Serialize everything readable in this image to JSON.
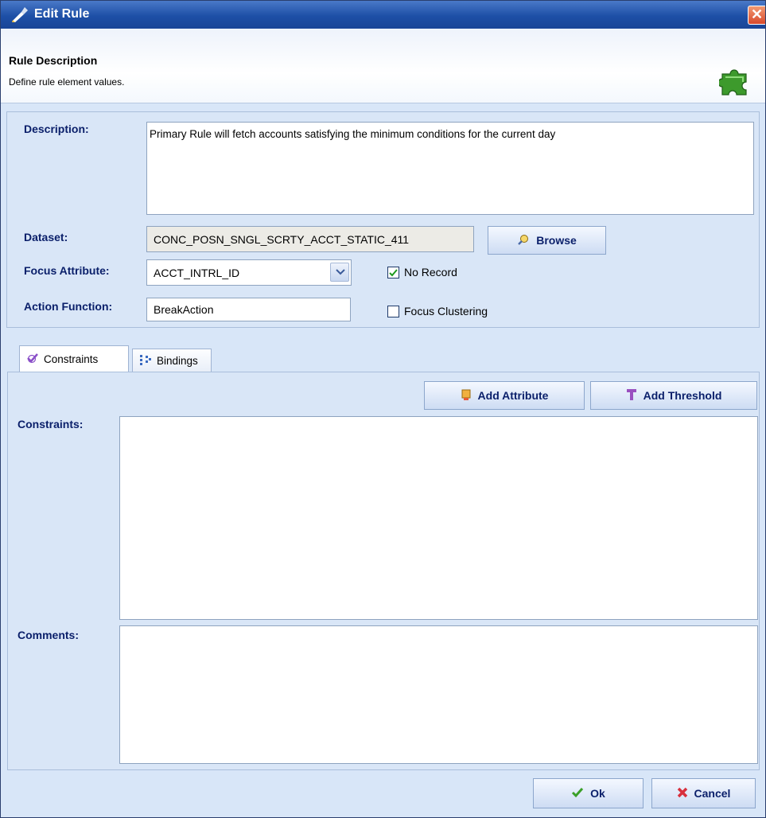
{
  "window": {
    "title": "Edit Rule",
    "close_glyph": "✕"
  },
  "header": {
    "title": "Rule Description",
    "subtitle": "Define rule element values."
  },
  "form": {
    "description_label": "Description:",
    "description_value": "Primary Rule will fetch accounts satisfying the minimum conditions  for the current day",
    "dataset_label": "Dataset:",
    "dataset_value": "CONC_POSN_SNGL_SCRTY_ACCT_STATIC_411",
    "browse_label": "Browse",
    "focus_attribute_label": "Focus Attribute:",
    "focus_attribute_value": "ACCT_INTRL_ID",
    "no_record_label": "No Record",
    "no_record_checked": true,
    "action_function_label": "Action Function:",
    "action_function_value": "BreakAction",
    "focus_clustering_label": "Focus Clustering",
    "focus_clustering_checked": false
  },
  "tabs": [
    {
      "label": "Constraints",
      "icon": "check-icon",
      "active": true
    },
    {
      "label": "Bindings",
      "icon": "bindings-icon",
      "active": false
    }
  ],
  "constraints_tab": {
    "add_attribute_label": "Add Attribute",
    "add_threshold_label": "Add Threshold",
    "constraints_label": "Constraints:",
    "comments_label": "Comments:"
  },
  "footer": {
    "ok_label": "Ok",
    "cancel_label": "Cancel"
  },
  "colors": {
    "title_bar": "#1d4fa6",
    "panel_bg": "#d9e6f7",
    "label_text": "#0a1f6a",
    "close_button": "#e0603c"
  }
}
